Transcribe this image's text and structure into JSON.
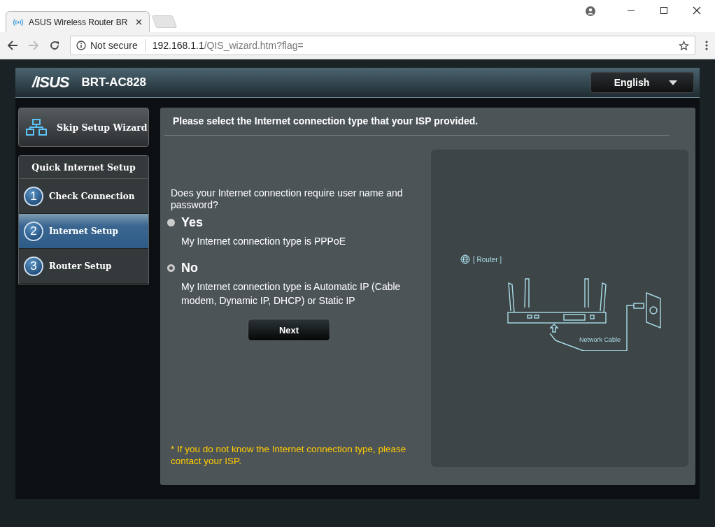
{
  "browser": {
    "tab_title": "ASUS Wireless Router BR",
    "security": "Not secure",
    "url_host": "192.168.1.1",
    "url_path": "/QIS_wizard.htm?flag="
  },
  "header": {
    "logo": "/ISUS",
    "model": "BRT-AC828",
    "language": "English"
  },
  "sidebar": {
    "skip_button": "Skip Setup Wizard",
    "section_title": "Quick Internet Setup",
    "steps": [
      {
        "number": "1",
        "label": "Check Connection",
        "selected": false
      },
      {
        "number": "2",
        "label": "Internet Setup",
        "selected": true
      },
      {
        "number": "3",
        "label": "Router Setup",
        "selected": false
      }
    ]
  },
  "main": {
    "heading": "Please select the Internet connection type that your ISP provided.",
    "question": "Does your Internet connection require user name and password?",
    "options": [
      {
        "label": "Yes",
        "description": "My Internet connection type is PPPoE",
        "selected": false
      },
      {
        "label": "No",
        "description": "My Internet connection type is Automatic IP (Cable modem, Dynamic IP, DHCP) or Static IP",
        "selected": true
      }
    ],
    "next_button": "Next",
    "note": "* If you do not know the Internet connection type, please contact your ISP.",
    "diagram": {
      "router_label": "[ Router ]",
      "cable_label": "Network Cable"
    }
  }
}
